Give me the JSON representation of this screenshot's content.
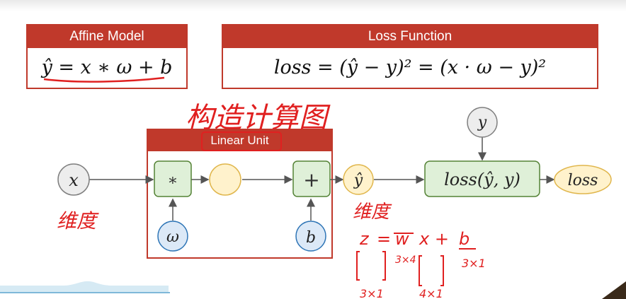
{
  "affine_model": {
    "title": "Affine Model",
    "formula": "ŷ = x ∗ ω + b"
  },
  "loss_function": {
    "title": "Loss Function",
    "formula": "loss = (ŷ − y)² = (x · ω − y)²"
  },
  "graph": {
    "linear_unit_label": "Linear Unit",
    "input_x": "x",
    "weight": "ω",
    "bias": "b",
    "multiply_op": "∗",
    "add_op": "+",
    "output_yhat": "ŷ",
    "target_y": "y",
    "loss_node": "loss(ŷ, y)",
    "loss_output": "loss"
  },
  "handwritten": {
    "title_note": "构造计算图",
    "x_dim_note": "维度",
    "yhat_dim_note": "维度",
    "equation_z": "z",
    "equation_eq": "=",
    "equation_w": "w",
    "equation_x_plus": "x +",
    "equation_b": "b",
    "w_shape": "3×4",
    "b_shape": "3×1",
    "z_shape": "3×1",
    "x_shape": "4×1"
  },
  "colors": {
    "header_red": "#c0392b",
    "node_green_fill": "#dff0d8",
    "node_green_stroke": "#548235",
    "node_blue_fill": "#dce9f7",
    "node_blue_stroke": "#2e75b6",
    "node_gray_fill": "#ededed",
    "node_gray_stroke": "#7f7f7f",
    "node_yellow_fill": "#fff2cc",
    "node_yellow_stroke": "#e0b64c",
    "ink_red": "#e02020"
  }
}
